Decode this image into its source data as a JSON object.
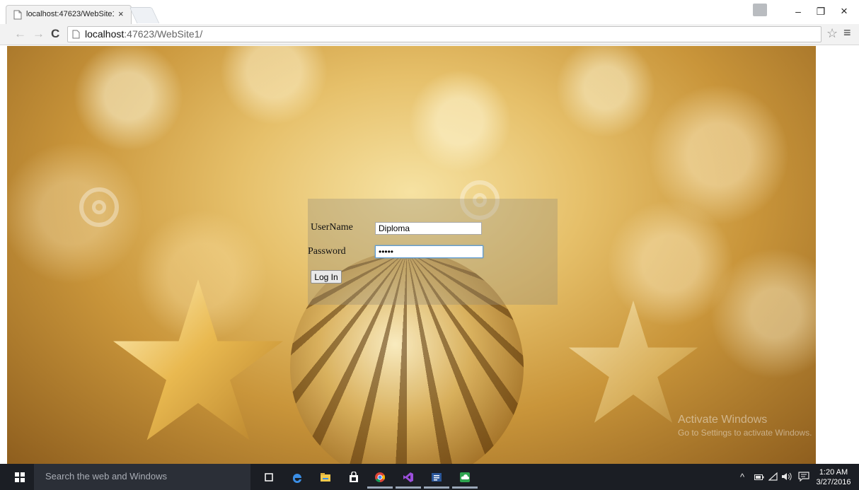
{
  "browser": {
    "tab_title": "localhost:47623/WebSite1",
    "tab_close": "×",
    "url_host": "localhost",
    "url_rest": ":47623/WebSite1/",
    "back_glyph": "←",
    "forward_glyph": "→",
    "reload_glyph": "C",
    "star_glyph": "☆",
    "menu_glyph": "≡",
    "minimize_glyph": "–",
    "restore_glyph": "❐",
    "close_glyph": "×"
  },
  "login": {
    "username_label": "UserName",
    "username_value": "Diploma",
    "password_label": "Password",
    "password_value": "•••••",
    "button_label": "Log In"
  },
  "overlay": {
    "line1": "Activate Windows",
    "line2": "Go to Settings to activate Windows."
  },
  "taskbar": {
    "search_placeholder": "Search the web and Windows",
    "tray_up_glyph": "^",
    "clock_time": "1:20 AM",
    "clock_date": "3/27/2016",
    "icons": [
      "task-view-icon",
      "edge-icon",
      "file-explorer-icon",
      "store-icon",
      "chrome-icon",
      "visual-studio-icon",
      "word-icon",
      "onedrive-icon"
    ]
  },
  "colors": {
    "taskbar_bg": "#1b1e24",
    "focus_ring": "#5b9bd5",
    "gold": "#e6c06a"
  }
}
